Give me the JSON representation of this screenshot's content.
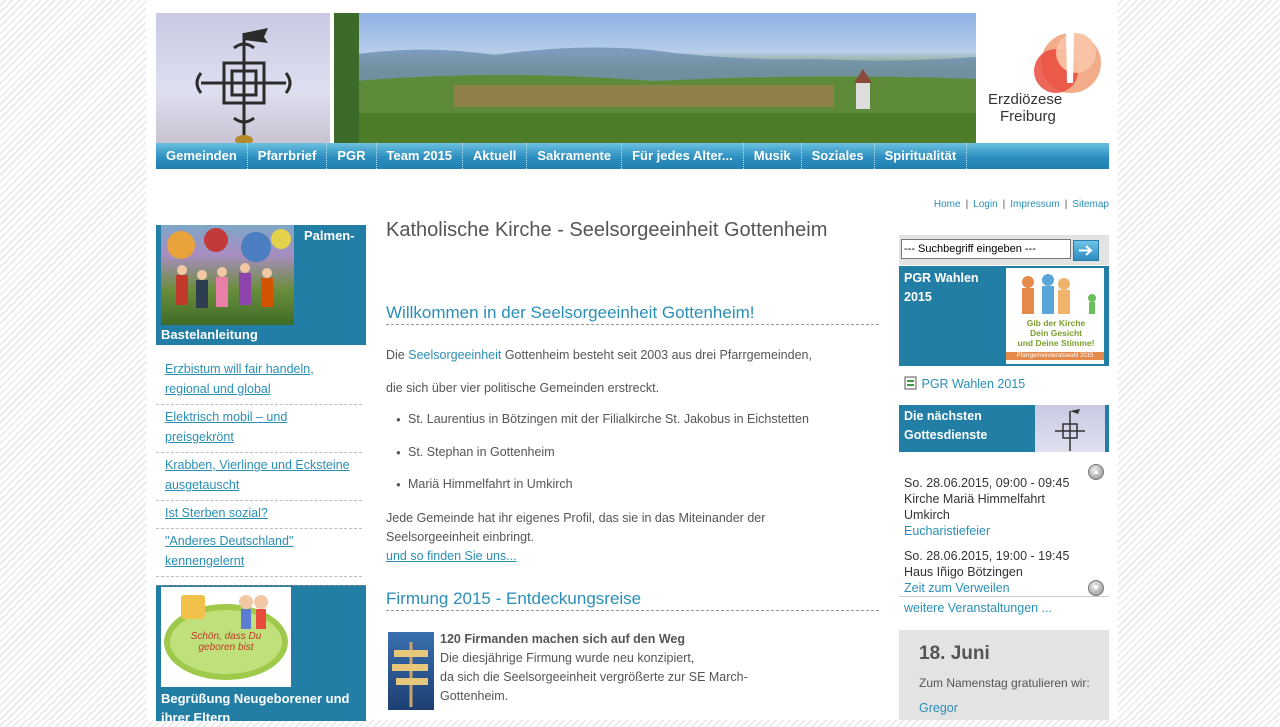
{
  "header": {
    "logo_text_line1": "Erzdiözese",
    "logo_text_line2": "Freiburg"
  },
  "nav": [
    "Gemeinden",
    "Pfarrbrief",
    "PGR",
    "Team 2015",
    "Aktuell",
    "Sakramente",
    "Für jedes Alter...",
    "Musik",
    "Soziales",
    "Spiritualität"
  ],
  "toplinks": [
    "Home",
    "Login",
    "Impressum",
    "Sitemap"
  ],
  "left": {
    "teaser1_caption_top": "Palmen-",
    "teaser1_caption_bottom": "Bastelanleitung",
    "links": [
      "Erzbistum will fair handeln, regional und global",
      "Elektrisch mobil – und preisgekrönt",
      "Krabben, Vierlinge und Ecksteine ausgetauscht",
      "Ist Sterben sozial?",
      "\"Anderes Deutschland\" kennengelernt"
    ],
    "teaser2_badge": "Schön, dass Du geboren bist",
    "teaser2_caption": "Begrüßung Neugeborener und ihrer Eltern"
  },
  "main": {
    "title": "Katholische Kirche - Seelsorgeeinheit Gottenheim",
    "welcome_heading": "Willkommen in der Seelsorgeeinheit Gottenheim!",
    "p1_prefix": "Die ",
    "p1_link": "Seelsorgeeinheit",
    "p1_suffix": " Gottenheim besteht seit 2003 aus drei Pfarrgemeinden,",
    "p2": "die sich über vier politische Gemeinden erstreckt.",
    "bullets": [
      "St. Laurentius in Bötzingen mit der Filialkirche St. Jakobus in Eichstetten",
      "St. Stephan in Gottenheim",
      "Mariä Himmelfahrt in Umkirch"
    ],
    "p3_line1": "Jede Gemeinde hat ihr eigenes Profil, das sie in das Miteinander der",
    "p3_line2": "Seelsorgeeinheit einbringt.",
    "more_link": "und so finden Sie uns...",
    "firmung_heading": "Firmung 2015 - Entdeckungsreise",
    "firmung_bold": "120 Firmanden machen sich auf den Weg",
    "firmung_l1": "Die diesjährige Firmung wurde neu konzipiert,",
    "firmung_l2": "da sich die Seelsorgeeinheit vergrößerte zur SE March-",
    "firmung_l3": "Gottenheim."
  },
  "right": {
    "search_placeholder": "--- Suchbegriff eingeben ---",
    "pgr_caption_1": "PGR Wahlen",
    "pgr_caption_2": "2015",
    "pgr_poster_1": "Gib der Kirche",
    "pgr_poster_2": "Dein Gesicht",
    "pgr_poster_3": "und Deine Stimme!",
    "pgr_poster_4": "Pfarrgemeinderatswahl 2015",
    "pgr_link": "PGR Wahlen 2015",
    "gd_caption_1": "Die nächsten",
    "gd_caption_2": "Gottesdienste",
    "events": [
      {
        "when": "So. 28.06.2015, 09:00 - 09:45",
        "where1": "Kirche Mariä Himmelfahrt",
        "where2": "Umkirch",
        "type": "Eucharistiefeier"
      },
      {
        "when": "So. 28.06.2015, 19:00 - 19:45",
        "where1": "Haus Iñigo Bötzingen",
        "where2": "",
        "type": "Zeit zum Verweilen"
      }
    ],
    "more_events": "weitere Veranstaltungen ...",
    "date": "18. Juni",
    "nameday_text": "Zum Namenstag gratulieren wir:",
    "nameday_name": "Gregor"
  },
  "colors": {
    "accent": "#2a8fb7",
    "teaser_bg": "#237ea6"
  }
}
